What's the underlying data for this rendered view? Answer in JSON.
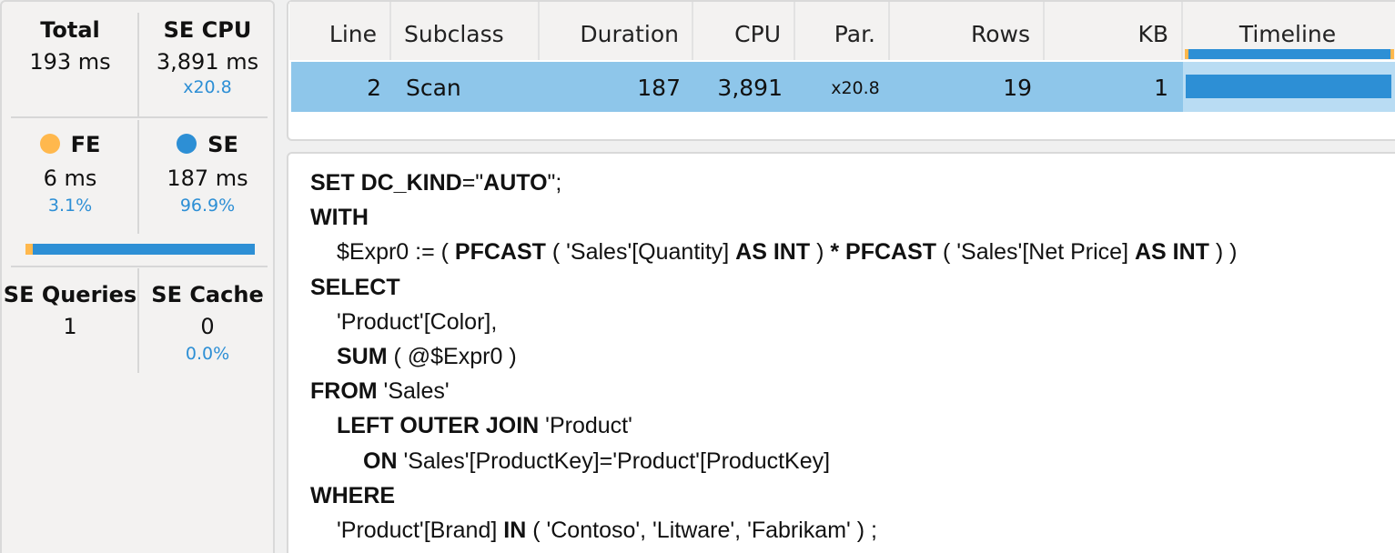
{
  "summary": {
    "total": {
      "label": "Total",
      "value": "193 ms"
    },
    "se_cpu": {
      "label": "SE CPU",
      "value": "3,891 ms",
      "sub": "x20.8"
    },
    "fe": {
      "label": "FE",
      "value": "6 ms",
      "pct": "3.1%",
      "color": "#ffb84d",
      "fraction": 0.031
    },
    "se": {
      "label": "SE",
      "value": "187 ms",
      "pct": "96.9%",
      "color": "#2d8fd5",
      "fraction": 0.969
    },
    "se_queries": {
      "label": "SE Queries",
      "value": "1"
    },
    "se_cache": {
      "label": "SE Cache",
      "value": "0",
      "pct": "0.0%"
    }
  },
  "table": {
    "headers": [
      "Line",
      "Subclass",
      "Duration",
      "CPU",
      "Par.",
      "Rows",
      "KB",
      "Timeline"
    ],
    "rows": [
      {
        "line": "2",
        "subclass": "Scan",
        "duration": "187",
        "cpu": "3,891",
        "par": "x20.8",
        "rows": "19",
        "kb": "1",
        "timeline_fraction": 1.0
      }
    ],
    "colors": {
      "selected_row": "#8ec6ea",
      "timeline_bar": "#2d8fd5",
      "fe_marker": "#ffb84d"
    }
  },
  "query": {
    "lines": [
      {
        "indent": 0,
        "parts": [
          {
            "t": "SET DC_KIND",
            "b": true
          },
          {
            "t": "=\"",
            "b": false
          },
          {
            "t": "AUTO",
            "b": true
          },
          {
            "t": "\";",
            "b": false
          }
        ]
      },
      {
        "indent": 0,
        "parts": [
          {
            "t": "WITH",
            "b": true
          }
        ]
      },
      {
        "indent": 1,
        "parts": [
          {
            "t": "$Expr0 := ( ",
            "b": false
          },
          {
            "t": "PFCAST",
            "b": true
          },
          {
            "t": " ( 'Sales'[Quantity] ",
            "b": false
          },
          {
            "t": "AS INT",
            "b": true
          },
          {
            "t": " ) ",
            "b": false
          },
          {
            "t": "*",
            "b": true
          },
          {
            "t": " ",
            "b": false
          },
          {
            "t": "PFCAST",
            "b": true
          },
          {
            "t": " ( 'Sales'[Net Price] ",
            "b": false
          },
          {
            "t": "AS INT",
            "b": true
          },
          {
            "t": " ) )",
            "b": false
          }
        ]
      },
      {
        "indent": 0,
        "parts": [
          {
            "t": "SELECT",
            "b": true
          }
        ]
      },
      {
        "indent": 1,
        "parts": [
          {
            "t": "'Product'[Color],",
            "b": false
          }
        ]
      },
      {
        "indent": 1,
        "parts": [
          {
            "t": "SUM",
            "b": true
          },
          {
            "t": " ( @$Expr0 )",
            "b": false
          }
        ]
      },
      {
        "indent": 0,
        "parts": [
          {
            "t": "FROM",
            "b": true
          },
          {
            "t": " 'Sales'",
            "b": false
          }
        ]
      },
      {
        "indent": 1,
        "parts": [
          {
            "t": "LEFT OUTER JOIN",
            "b": true
          },
          {
            "t": " 'Product'",
            "b": false
          }
        ]
      },
      {
        "indent": 2,
        "parts": [
          {
            "t": "ON",
            "b": true
          },
          {
            "t": " 'Sales'[ProductKey]='Product'[ProductKey]",
            "b": false
          }
        ]
      },
      {
        "indent": 0,
        "parts": [
          {
            "t": "WHERE",
            "b": true
          }
        ]
      },
      {
        "indent": 1,
        "parts": [
          {
            "t": "'Product'[Brand] ",
            "b": false
          },
          {
            "t": "IN",
            "b": true
          },
          {
            "t": " ( 'Contoso', 'Litware', 'Fabrikam' ) ;",
            "b": false
          }
        ]
      }
    ]
  }
}
